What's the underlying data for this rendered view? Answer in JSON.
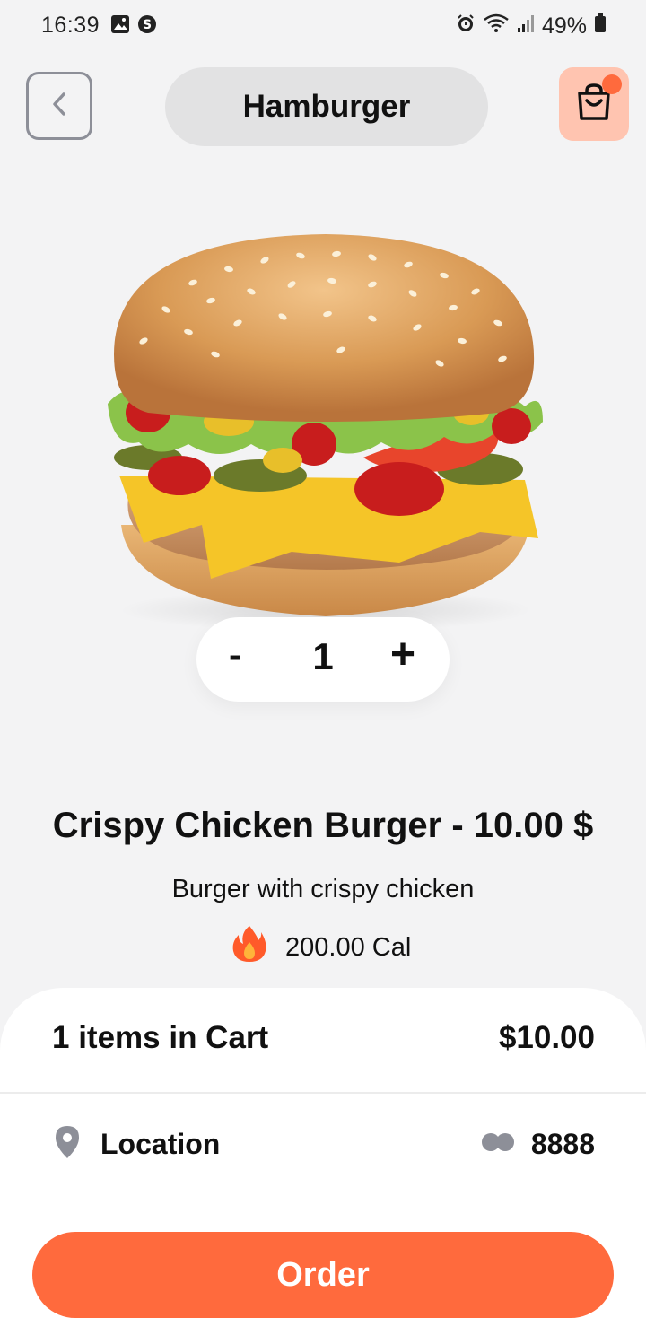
{
  "status_bar": {
    "time": "16:39",
    "battery": "49%",
    "icons": [
      "gallery-icon",
      "s-app-icon",
      "alarm-icon",
      "wifi-icon",
      "signal-icon",
      "battery-icon"
    ]
  },
  "header": {
    "back_icon": "chevron-left-icon",
    "title": "Hamburger",
    "cart_icon": "shopping-bag-icon"
  },
  "product": {
    "quantity": {
      "minus_label": "-",
      "value": "1",
      "plus_label": "+"
    },
    "title": "Crispy Chicken Burger - 10.00 $",
    "description": "Burger with crispy chicken",
    "calories_icon": "fire-icon",
    "calories": "200.00 Cal"
  },
  "cart_summary": {
    "items_label": "1 items in Cart",
    "total": "$10.00"
  },
  "delivery": {
    "location_icon": "location-pin-icon",
    "location_label": "Location",
    "points_icon": "coins-icon",
    "points": "8888"
  },
  "actions": {
    "order_label": "Order"
  },
  "colors": {
    "accent": "#ff6a3d",
    "cart_button_bg": "#ffc4b0",
    "background": "#f3f3f4",
    "title_pill_bg": "#e2e2e3"
  }
}
